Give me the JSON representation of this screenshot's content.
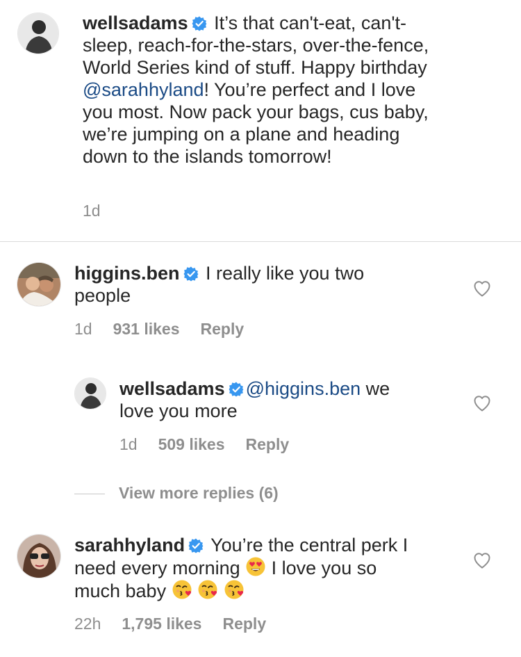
{
  "caption": {
    "username": "wellsadams",
    "text_before": " It’s that can't-eat, can't-sleep, reach-for-the-stars, over-the-fence, World Series kind of stuff. Happy birthday ",
    "mention": "@sarahhyland",
    "text_after": "! You’re perfect and I love you most. Now pack your bags, cus baby, we’re jumping on a plane and heading down to the islands tomorrow!",
    "time": "1d"
  },
  "comment1": {
    "username": "higgins.ben",
    "text": " I really like you two people",
    "time": "1d",
    "likes": "931 likes",
    "reply": "Reply"
  },
  "reply1": {
    "username": "wellsadams",
    "mention": "@higgins.ben",
    "text": " we love you more",
    "time": "1d",
    "likes": "509 likes",
    "reply": "Reply"
  },
  "view_more_replies": "View more replies (6)",
  "comment2": {
    "username": "sarahhyland",
    "text_before": " You’re the central perk I need every morning ",
    "text_after": " I love you so much baby ",
    "time": "22h",
    "likes": "1,795 likes",
    "reply": "Reply"
  },
  "icons": {
    "verified_badge": "verified-badge-icon",
    "like": "heart-outline-icon",
    "emoji_heart_eyes": "heart-eyes-emoji",
    "emoji_kiss": "kissing-heart-emoji"
  },
  "colors": {
    "text": "#262626",
    "muted": "#8e8e8e",
    "mention": "#1a4a85",
    "verified": "#3897f0",
    "divider": "#dbdbdb"
  }
}
